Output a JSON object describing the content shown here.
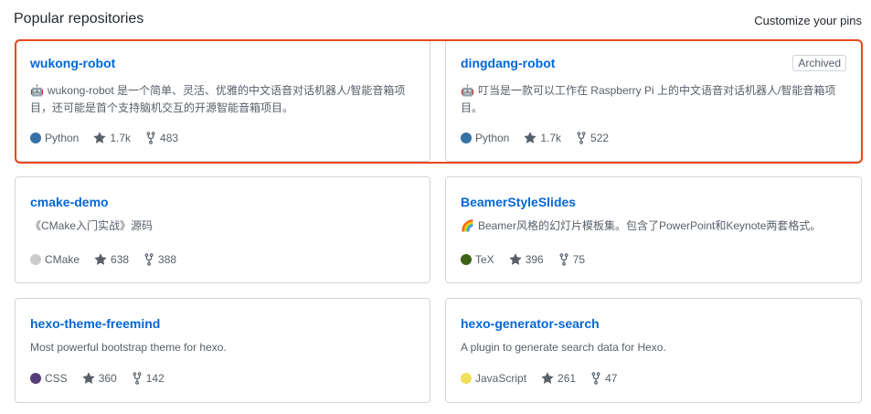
{
  "header": {
    "title": "Popular repositories",
    "customize": "Customize your pins"
  },
  "repos": [
    {
      "name": "wukong-robot",
      "archived": "",
      "emoji": "🤖",
      "description": "wukong-robot 是一个简单、灵活、优雅的中文语音对话机器人/智能音箱项目，还可能是首个支持脑机交互的开源智能音箱项目。",
      "language": "Python",
      "language_color": "#3572A5",
      "stars": "1.7k",
      "forks": "483"
    },
    {
      "name": "dingdang-robot",
      "archived": "Archived",
      "emoji": "🤖",
      "description": "叮当是一款可以工作在 Raspberry Pi 上的中文语音对话机器人/智能音箱项目。",
      "language": "Python",
      "language_color": "#3572A5",
      "stars": "1.7k",
      "forks": "522"
    },
    {
      "name": "cmake-demo",
      "archived": "",
      "emoji": "",
      "description": "《CMake入门实战》源码",
      "language": "CMake",
      "language_color": "#cccccc",
      "stars": "638",
      "forks": "388"
    },
    {
      "name": "BeamerStyleSlides",
      "archived": "",
      "emoji": "🌈",
      "description": "Beamer风格的幻灯片模板集。包含了PowerPoint和Keynote两套格式。",
      "language": "TeX",
      "language_color": "#3D6117",
      "stars": "396",
      "forks": "75"
    },
    {
      "name": "hexo-theme-freemind",
      "archived": "",
      "emoji": "",
      "description": "Most powerful bootstrap theme for hexo.",
      "language": "CSS",
      "language_color": "#563d7c",
      "stars": "360",
      "forks": "142"
    },
    {
      "name": "hexo-generator-search",
      "archived": "",
      "emoji": "",
      "description": "A plugin to generate search data for Hexo.",
      "language": "JavaScript",
      "language_color": "#f1e05a",
      "stars": "261",
      "forks": "47"
    }
  ],
  "highlight_color": "#e8471c"
}
